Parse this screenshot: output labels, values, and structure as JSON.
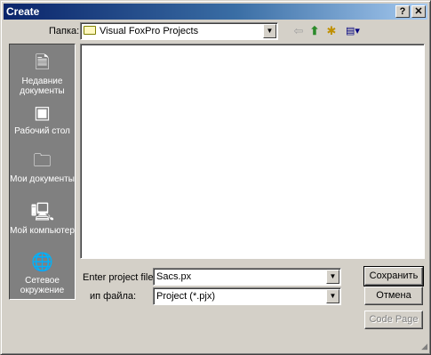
{
  "window": {
    "title": "Create",
    "help_label": "?",
    "close_label": "✕"
  },
  "lookin": {
    "label": "Папка:",
    "value": "Visual FoxPro Projects"
  },
  "toolbar": {
    "back": "⇦",
    "up": "⬆",
    "new_folder": "✱",
    "views": "▤▾"
  },
  "places": [
    {
      "icon": "🗎",
      "label": "Недавние документы"
    },
    {
      "icon": "▣",
      "label": "Рабочий стол"
    },
    {
      "icon": "🗀",
      "label": "Мои документы"
    },
    {
      "icon": "🖳",
      "label": "Мой компьютер"
    },
    {
      "icon": "🌐",
      "label": "Сетевое окружение"
    }
  ],
  "form": {
    "name_label": "Enter project file",
    "name_value": "Sacs.px",
    "type_label": "ип файла:",
    "type_value": "Project (*.pjx)",
    "arrow": "▼"
  },
  "buttons": {
    "save": "Сохранить",
    "cancel": "Отмена",
    "code_page": "Code Page"
  }
}
